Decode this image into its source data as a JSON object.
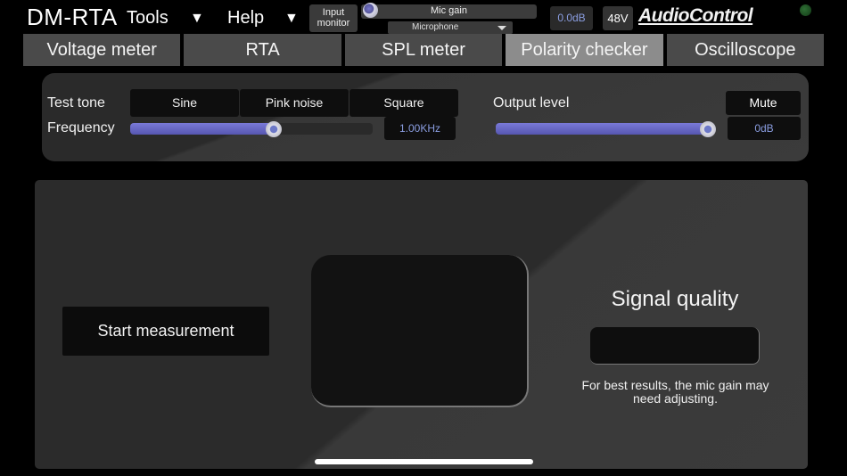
{
  "app": {
    "title": "DM-RTA",
    "brand": "AudioControl"
  },
  "menu": {
    "tools_label": "Tools",
    "help_label": "Help",
    "arrow": "▼"
  },
  "header": {
    "input_monitor_label": "Input\nmonitor",
    "mic_gain_label": "Mic gain",
    "mic_gain_value_fraction": 0.0,
    "mic_gain_readout": "0.0dB",
    "mic_source": "Microphone",
    "phantom_label": "48V",
    "status_led_color": "#1e5a24"
  },
  "tabs": [
    {
      "label": "Voltage meter",
      "active": false
    },
    {
      "label": "RTA",
      "active": false
    },
    {
      "label": "SPL meter",
      "active": false
    },
    {
      "label": "Polarity checker",
      "active": true
    },
    {
      "label": "Oscilloscope",
      "active": false
    }
  ],
  "generator": {
    "test_tone_label": "Test tone",
    "tones": [
      "Sine",
      "Pink noise",
      "Square"
    ],
    "frequency_label": "Frequency",
    "frequency_fraction": 0.57,
    "frequency_readout": "1.00KHz",
    "output_level_label": "Output level",
    "output_fraction": 0.97,
    "output_readout": "0dB",
    "mute_label": "Mute"
  },
  "polarity": {
    "start_label": "Start measurement",
    "signal_quality_label": "Signal quality",
    "hint": "For best results, the mic gain may need adjusting."
  },
  "colors": {
    "accent": "#6c78c8",
    "readout_text": "#8a9de0",
    "active_tab": "#8c8c8c",
    "tab": "#4a4a4a"
  }
}
